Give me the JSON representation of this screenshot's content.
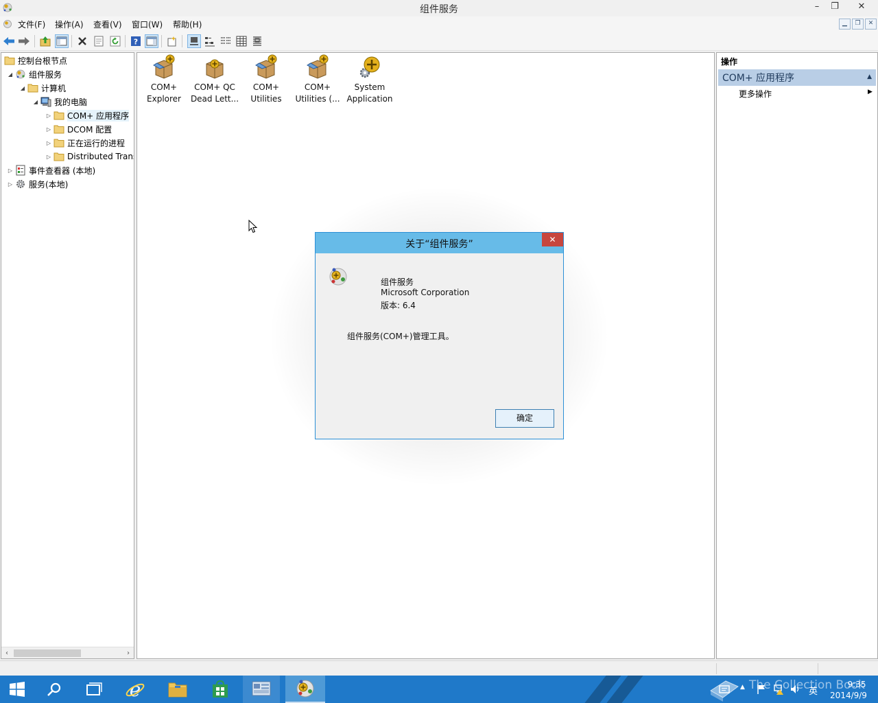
{
  "window": {
    "title": "组件服务",
    "minimize_glyph": "–",
    "restore_glyph": "❐",
    "close_glyph": "✕"
  },
  "menu": {
    "items": [
      "文件(F)",
      "操作(A)",
      "查看(V)",
      "窗口(W)",
      "帮助(H)"
    ]
  },
  "tree": {
    "nodes": [
      {
        "label": "控制台根节点",
        "expander": ""
      },
      {
        "label": "组件服务",
        "expander": "◢"
      },
      {
        "label": "计算机",
        "expander": "◢"
      },
      {
        "label": "我的电脑",
        "expander": "◢"
      },
      {
        "label": "COM+ 应用程序",
        "expander": "▷"
      },
      {
        "label": "DCOM 配置",
        "expander": "▷"
      },
      {
        "label": "正在运行的进程",
        "expander": "▷"
      },
      {
        "label": "Distributed Transaction Coordinator",
        "expander": "▷"
      },
      {
        "label": "事件查看器 (本地)",
        "expander": "▷"
      },
      {
        "label": "服务(本地)",
        "expander": "▷"
      }
    ]
  },
  "content": {
    "items": [
      {
        "line1": "COM+",
        "line2": "Explorer",
        "icon": "com-package-icon"
      },
      {
        "line1": "COM+ QC",
        "line2": "Dead Lett...",
        "icon": "com-package-icon"
      },
      {
        "line1": "COM+",
        "line2": "Utilities",
        "icon": "com-package-icon"
      },
      {
        "line1": "COM+",
        "line2": "Utilities (...",
        "icon": "com-package-icon"
      },
      {
        "line1": "System",
        "line2": "Application",
        "icon": "system-application-icon"
      }
    ]
  },
  "actions": {
    "header": "操作",
    "group": "COM+ 应用程序",
    "more": "更多操作"
  },
  "dialog": {
    "title": "关于“组件服务”",
    "product": "组件服务",
    "company": "Microsoft Corporation",
    "version": "版本: 6.4",
    "description": "组件服务(COM+)管理工具。",
    "ok_label": "确定",
    "close_glyph": "✕"
  },
  "taskbar": {
    "tray_lang": "英",
    "watermark": "The Collection Book",
    "time": "9:35",
    "date": "2014/9/9"
  },
  "colors": {
    "taskbar": "#1f79c9",
    "dialog_titlebar": "#67bbe8",
    "actions_group": "#b9cee6"
  }
}
